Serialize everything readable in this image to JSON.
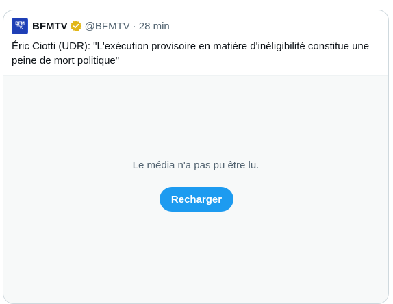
{
  "tweet": {
    "account_name": "BFMTV",
    "avatar_lines": [
      "BFM",
      "TV."
    ],
    "handle": "@BFMTV",
    "separator": "·",
    "time": "28 min",
    "text": "Éric Ciotti (UDR): \"L'exécution provisoire en matière d'inéligibilité constitue une peine de mort politique\"",
    "verified_badge": "gold-verified-icon"
  },
  "media": {
    "error_message": "Le média n'a pas pu être lu.",
    "reload_label": "Recharger"
  },
  "colors": {
    "accent": "#1d9bf0",
    "badge_gold": "#e2b719",
    "avatar_blue": "#1f3fb5",
    "secondary_text": "#536471",
    "primary_text": "#0f1419",
    "media_bg": "#f7f9f9"
  }
}
